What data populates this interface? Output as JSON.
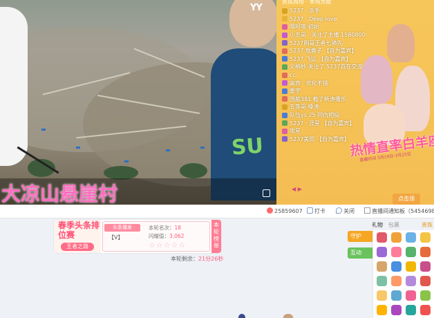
{
  "video": {
    "logo": "YY",
    "caption": "大凉山悬崖村"
  },
  "chat": {
    "header": "贵族周榜 · 本场贡献",
    "messages": [
      {
        "name": "5237 · 杀手",
        "color": "#d9a323"
      },
      {
        "name": "5237 · Deep love",
        "color": "#e6b43a"
      },
      {
        "name": "哦呵嗒·初始",
        "color": "#e15ea0"
      },
      {
        "name": "小五哥 · 关注了主播 1580800",
        "color": "#c35bd1"
      },
      {
        "name": "5237刚哥王者七骑先",
        "color": "#8462c9"
      },
      {
        "name": "5237 敖鹿子 【自为嘉宾】",
        "color": "#e06d5a"
      },
      {
        "name": "5237 飞远 【自为嘉宾】",
        "color": "#4b7bd6"
      },
      {
        "name": "尖梢秒 关注了 5237自在交流",
        "color": "#5fa65b"
      },
      {
        "name": "cc",
        "color": "#e06d5a"
      },
      {
        "name": "高宾 · 优化不错",
        "color": "#c35bd1"
      },
      {
        "name": "姜宇",
        "color": "#4b7bd6"
      },
      {
        "name": "国舶381 截了新涛播乐",
        "color": "#e06d5a"
      },
      {
        "name": "五等哥·嗓涛",
        "color": "#d9a323"
      },
      {
        "name": "队伍ys 25 同仇相投",
        "color": "#4b7bd6"
      },
      {
        "name": "5237 · 涯星 【自为嘉宾】",
        "color": "#5fa65b"
      },
      {
        "name": "攻星",
        "color": "#e15ea0"
      },
      {
        "name": "5237美照 【自为嘉宾】",
        "color": "#8462c9"
      }
    ],
    "poster_title": "热情直率白羊座",
    "poster_sub": "直播时间 3月19日-3月25日",
    "arrows": "◀ ▶",
    "action_button": "点击领"
  },
  "status": {
    "viewers": "25859607",
    "checkin": "打卡",
    "location": "关闭",
    "notify": "直播间通知板（5454698）"
  },
  "ad": {
    "logo_title": "春季头条排位赛",
    "logo_badge": "王者之路",
    "tag": "头条播发",
    "vip": "【V】",
    "round_count_label": "本轮名次：",
    "round_count_value": "18",
    "score_label": "闪耀值：",
    "score_value": "3,062",
    "stars": "☆☆☆☆☆",
    "side_label": "本轮榜单",
    "countdown_label": "本轮剩余：",
    "countdown_value": "21分26秒"
  },
  "gifts": {
    "tabs": [
      "礼物",
      "包裹",
      "贵族"
    ],
    "guard_label": "守护",
    "interact_label": "互动"
  }
}
